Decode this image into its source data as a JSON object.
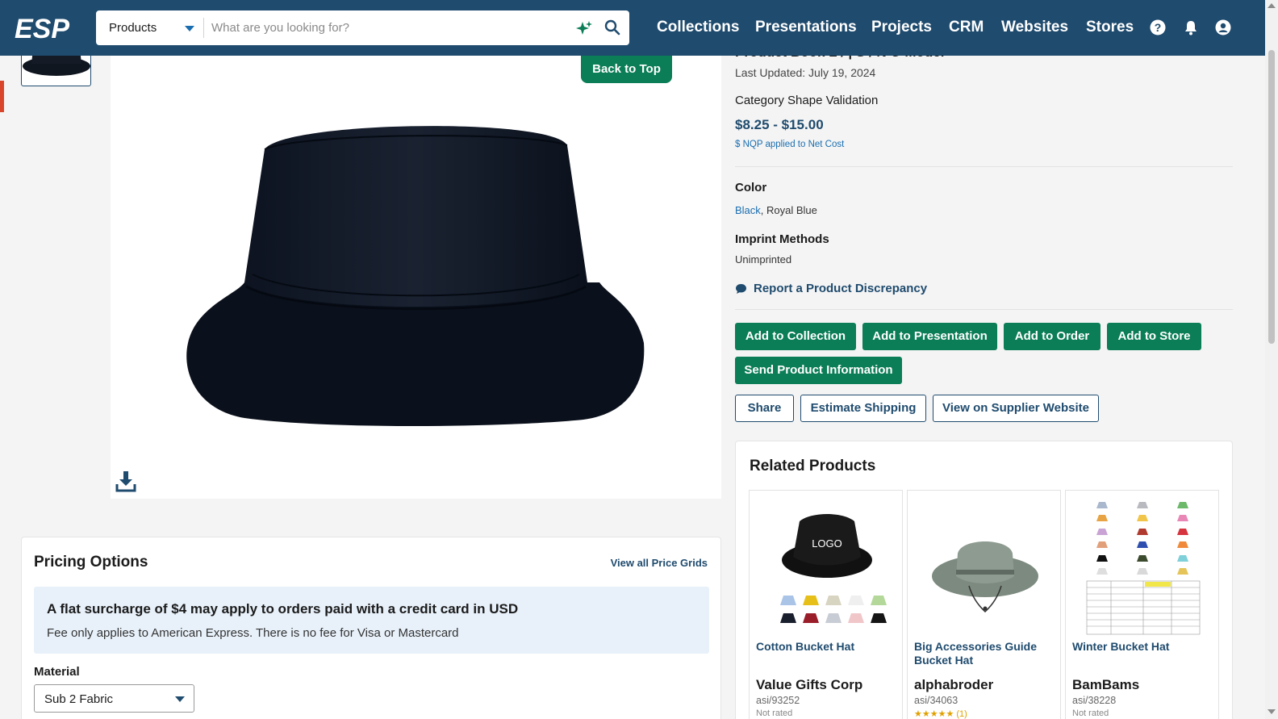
{
  "header": {
    "logo_text": "ESP",
    "search": {
      "scope": "Products",
      "placeholder": "What are you looking for?"
    },
    "nav": [
      "Collections",
      "Presentations",
      "Projects",
      "CRM",
      "Websites",
      "Stores"
    ],
    "icons": [
      "help-icon",
      "bell-icon",
      "account-icon"
    ]
  },
  "product": {
    "title_partial": "Product Book L / | S / N O Model",
    "last_updated": "Last Updated: July 19, 2024",
    "category_shape": "Category Shape Validation",
    "price": "$8.25 - $15.00",
    "nqp_note": "$ NQP applied to Net Cost",
    "color_label": "Color",
    "color_link": "Black",
    "color_rest": ", Royal Blue",
    "imprint_label": "Imprint Methods",
    "imprint_value": "Unimprinted",
    "discrepancy": "Report a Product Discrepancy",
    "back_to_top": "Back to Top"
  },
  "actions": {
    "add_to_collection": "Add to Collection",
    "add_to_presentation": "Add to Presentation",
    "add_to_order": "Add to Order",
    "add_to_store": "Add to Store",
    "send_info": "Send Product Information",
    "share": "Share",
    "estimate_shipping": "Estimate Shipping",
    "view_supplier": "View on Supplier Website"
  },
  "related": {
    "title": "Related Products",
    "items": [
      {
        "name": "Cotton Bucket Hat",
        "supplier": "Value Gifts Corp",
        "asi": "asi/93252",
        "extra": "Not rated"
      },
      {
        "name": "Big Accessories Guide Bucket Hat",
        "supplier": "alphabroder",
        "asi": "asi/34063",
        "extra": "★★★★★ (1)"
      },
      {
        "name": "Winter Bucket Hat",
        "supplier": "BamBams",
        "asi": "asi/38228",
        "extra": "Not rated"
      }
    ],
    "logo_text": "LOGO"
  },
  "pricing": {
    "title": "Pricing Options",
    "view_all": "View all Price Grids",
    "notice_heading": "A flat surcharge of $4 may apply to orders paid with a credit card in USD",
    "notice_body": "Fee only applies to American Express. There is no fee for Visa or Mastercard",
    "material_label": "Material",
    "material_value": "Sub 2 Fabric"
  },
  "colors": {
    "header": "#1f4b6e",
    "primary_button": "#0b7d57",
    "link": "#1a6eb0",
    "notice_bg": "#e8f1fa"
  }
}
